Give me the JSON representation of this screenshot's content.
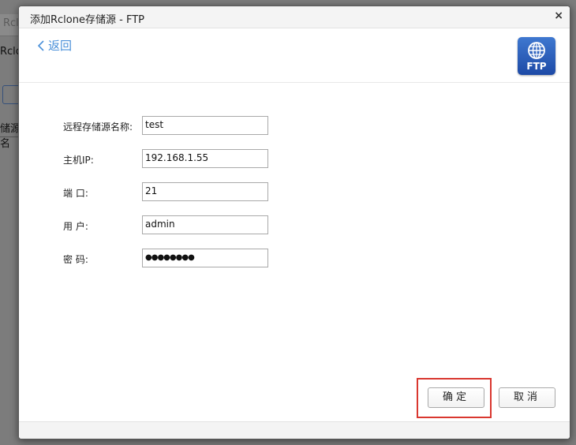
{
  "background": {
    "tab_fragment": "Rcl",
    "title_fragment": "Rclon",
    "column_fragment": "储源名"
  },
  "dialog": {
    "title": "添加Rclone存储源 - FTP",
    "close_label": "×",
    "back_label": "返回",
    "logo_text": "FTP"
  },
  "form": {
    "fields": [
      {
        "label": "远程存储源名称:",
        "value": "test"
      },
      {
        "label": "主机IP:",
        "value": "192.168.1.55"
      },
      {
        "label": "端 口:",
        "value": "21"
      },
      {
        "label": "用 户:",
        "value": "admin"
      },
      {
        "label": "密 码:",
        "value": "●●●●●●●●"
      }
    ]
  },
  "buttons": {
    "ok_label": "确定",
    "cancel_label": "取消"
  },
  "colors": {
    "accent": "#4a90d9",
    "logo": "#2b5fc0",
    "highlight": "#d9372f"
  }
}
